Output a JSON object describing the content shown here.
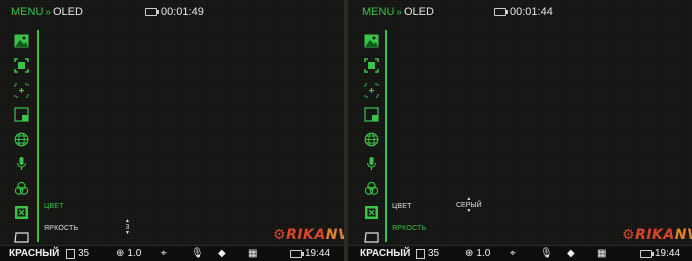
{
  "menu": {
    "label": "MENU",
    "separator": "»",
    "section": "OLED"
  },
  "colors": {
    "accent": "#39c34a",
    "logo_red": "#d9452a",
    "logo_orange": "#e0832b"
  },
  "sidebar_icons": [
    "image-icon",
    "crosshair-icon",
    "zoom-crosshair-icon",
    "pip-icon",
    "globe-icon",
    "microphone-icon",
    "color-circles-icon",
    "close-box-icon",
    "screen-icon"
  ],
  "left": {
    "timer": "00:01:49",
    "rows": [
      {
        "label": "ЦВЕТ",
        "state": "active"
      },
      {
        "label": "ЯРКОСТЬ",
        "state": "inactive",
        "value": "3"
      }
    ]
  },
  "right": {
    "timer": "00:01:44",
    "rows": [
      {
        "label": "ЦВЕТ",
        "state": "inactive",
        "value": "СЕРЫЙ"
      },
      {
        "label": "ЯРКОСТЬ",
        "state": "active"
      }
    ]
  },
  "logo": {
    "prefix": "RIKA",
    "suffix": "NV"
  },
  "status": {
    "palette": "КРАСНЫЙ",
    "value": "35",
    "zoom": "1.0",
    "time": "19:44"
  }
}
